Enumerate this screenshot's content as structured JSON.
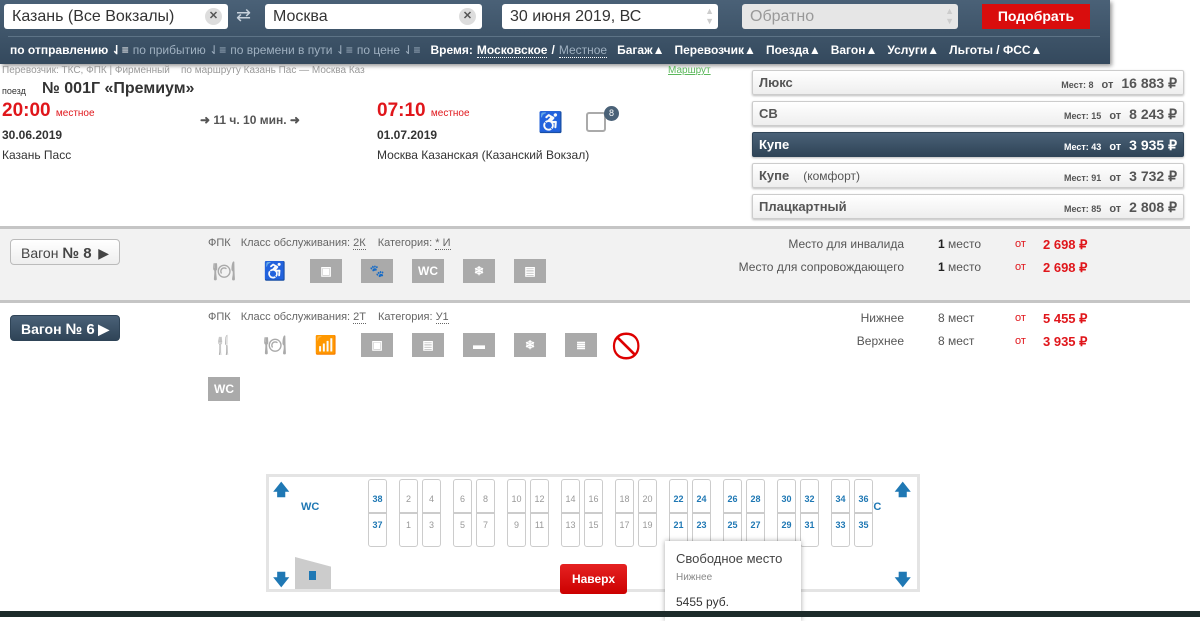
{
  "search": {
    "from": "Казань (Все Вокзалы)",
    "to": "Москва",
    "date": "30 июня 2019, ВС",
    "return_placeholder": "Обратно",
    "submit": "Подобрать"
  },
  "sort": {
    "by_departure": "по отправлению",
    "by_arrival": "по прибытию",
    "by_duration": "по времени в пути",
    "by_price": "по цене"
  },
  "time": {
    "label": "Время:",
    "moscow": "Московское",
    "sep": "/",
    "local": "Местное"
  },
  "filters": [
    "Багаж",
    "Перевозчик",
    "Поезда",
    "Вагон",
    "Услуги",
    "Льготы / ФСС"
  ],
  "train": {
    "carrier_line": "Перевозчик: ТКС, ФПК | Фирменный    по маршруту Казань Пас — Москва Каз",
    "route_link": "Маршрут",
    "label": "поезд",
    "number": "№ 001Г «Премиум»",
    "dep_time": "20:00",
    "dep_note": "местное",
    "dep_date": "30.06.2019",
    "dep_station": "Казань Пасс",
    "duration": "11 ч. 10 мин.",
    "arr_time": "07:10",
    "arr_note": "местное",
    "arr_date": "01.07.2019",
    "arr_station": "Москва Казанская (Казанский Вокзал)",
    "wagon_badge": "8"
  },
  "classes": [
    {
      "name": "Люкс",
      "sub": "",
      "seats": "Мест: 8",
      "from": "от",
      "price": "16 883 ₽",
      "selected": false
    },
    {
      "name": "СВ",
      "sub": "",
      "seats": "Мест: 15",
      "from": "от",
      "price": "8 243 ₽",
      "selected": false
    },
    {
      "name": "Купе",
      "sub": "",
      "seats": "Мест: 43",
      "from": "от",
      "price": "3 935 ₽",
      "selected": true
    },
    {
      "name": "Купе",
      "sub": "(комфорт)",
      "seats": "Мест: 91",
      "from": "от",
      "price": "3 732 ₽",
      "selected": false
    },
    {
      "name": "Плацкартный",
      "sub": "",
      "seats": "Мест: 85",
      "from": "от",
      "price": "2 808 ₽",
      "selected": false
    }
  ],
  "wagons": [
    {
      "label": "Вагон",
      "num": "№ 8",
      "carrier": "ФПК",
      "class_label": "Класс обслуживания:",
      "class": "2К",
      "cat_label": "Категория:",
      "cat": "* И",
      "icons": [
        "meal-icon",
        "wheelchair-icon",
        "bag-icon",
        "pet-icon",
        "wc-icon",
        "ac-icon",
        "linen-icon"
      ],
      "prices": [
        {
          "type": "Место для инвалида",
          "count_b": "1",
          "count": "место",
          "from": "от",
          "price": "2 698 ₽"
        },
        {
          "type": "Место для сопровождающего",
          "count_b": "1",
          "count": "место",
          "from": "от",
          "price": "2 698 ₽"
        }
      ]
    },
    {
      "label": "Вагон",
      "num": "№ 6",
      "carrier": "ФПК",
      "class_label": "Класс обслуживания:",
      "class": "2Т",
      "cat_label": "Категория:",
      "cat": "У1",
      "icons": [
        "food-icon",
        "meal-icon",
        "chart-icon",
        "bag-icon",
        "linen-icon",
        "hygiene-kit-icon",
        "ac-icon",
        "press-icon",
        "no-pets-icon",
        "wc-icon"
      ],
      "prices": [
        {
          "type": "Нижнее",
          "count_b": "",
          "count": "8 мест",
          "from": "от",
          "price": "5 455 ₽"
        },
        {
          "type": "Верхнее",
          "count_b": "",
          "count": "8 мест",
          "from": "от",
          "price": "3 935 ₽"
        }
      ]
    }
  ],
  "seatmap": {
    "wc": "WC",
    "upper": [
      "38",
      "2",
      "4",
      "6",
      "8",
      "10",
      "12",
      "14",
      "16",
      "18",
      "20",
      "22",
      "24",
      "26",
      "28",
      "30",
      "32",
      "34",
      "36"
    ],
    "lower": [
      "37",
      "1",
      "3",
      "5",
      "7",
      "9",
      "11",
      "13",
      "15",
      "17",
      "19",
      "21",
      "23",
      "25",
      "27",
      "29",
      "31",
      "33",
      "35"
    ],
    "free_from": 21,
    "top_button": "Наверх"
  },
  "tooltip": {
    "title": "Свободное место",
    "type": "Нижнее",
    "price": "5455 руб."
  },
  "colors": {
    "header": "#3d5468",
    "accent": "#d90d0d",
    "free_seat": "#1f78b4"
  }
}
